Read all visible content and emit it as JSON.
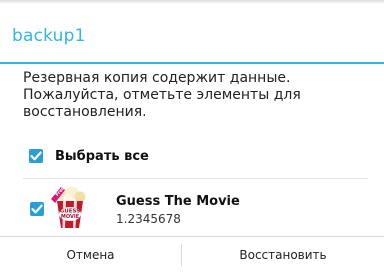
{
  "dialog": {
    "title": "backup1",
    "message": "Резервная копия содержит данные. Пожалуйста, отметьте элементы для восстановления.",
    "accent_color": "#33b5e5"
  },
  "select_all": {
    "label": "Выбрать все",
    "checked": true
  },
  "items": [
    {
      "name": "Guess The Movie",
      "version": "1.2345678",
      "checked": true,
      "icon": "guess-the-movie-app-icon"
    }
  ],
  "buttons": {
    "cancel": "Отмена",
    "restore": "Восстановить"
  }
}
